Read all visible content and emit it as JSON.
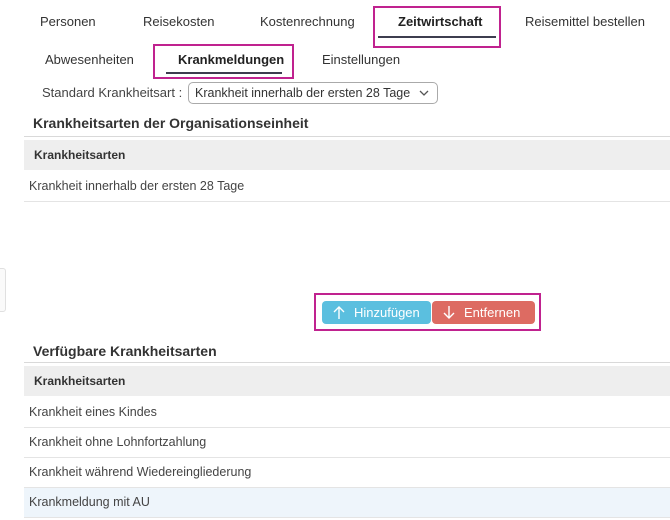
{
  "colors": {
    "highlight": "#c0228f",
    "add_button": "#5bbfdf",
    "remove_button": "#dd6b62",
    "header_bg": "#eeeeee",
    "selected_row_bg": "#eef5fb"
  },
  "top_tabs": [
    "Personen",
    "Reisekosten",
    "Kostenrechnung",
    "Zeitwirtschaft",
    "Reisemittel bestellen"
  ],
  "top_tab_active": "Zeitwirtschaft",
  "sub_tabs": [
    "Abwesenheiten",
    "Krankmeldungen",
    "Einstellungen"
  ],
  "sub_tab_active": "Krankmeldungen",
  "standard": {
    "label": "Standard Krankheitsart :",
    "value": "Krankheit innerhalb der ersten 28 Tage",
    "icon": "chevron-down-icon"
  },
  "assigned": {
    "title": "Krankheitsarten der Organisationseinheit",
    "column": "Krankheitsarten",
    "rows": [
      "Krankheit innerhalb der ersten 28 Tage"
    ]
  },
  "actions": {
    "add_label": "Hinzufügen",
    "add_icon": "arrow-up-icon",
    "remove_label": "Entfernen",
    "remove_icon": "arrow-down-icon"
  },
  "available": {
    "title": "Verfügbare Krankheitsarten",
    "column": "Krankheitsarten",
    "rows": [
      "Krankheit eines Kindes",
      "Krankheit ohne Lohnfortzahlung",
      "Krankheit während Wiedereingliederung",
      "Krankmeldung mit AU"
    ],
    "selected_row": "Krankmeldung mit AU"
  }
}
